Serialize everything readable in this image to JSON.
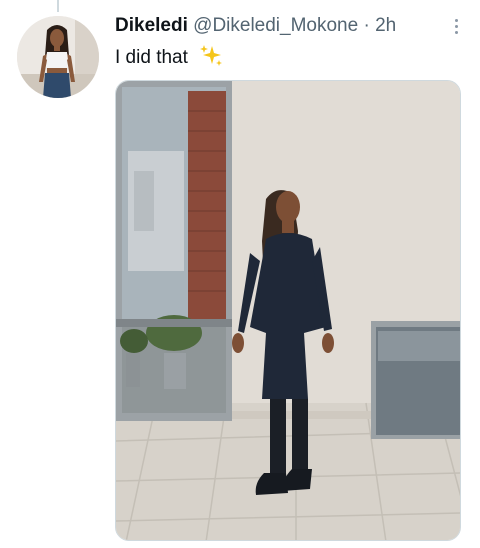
{
  "tweet": {
    "display_name": "Dikeledi",
    "handle": "@Dikeledi_Mokone",
    "separator": "·",
    "timestamp": "2h",
    "text": "I did that",
    "emoji_icon": "sparkles-icon"
  },
  "colors": {
    "name": "#0f1419",
    "meta": "#536471",
    "thread_line": "#cfd9de",
    "sparkle": "#f5c51a"
  }
}
